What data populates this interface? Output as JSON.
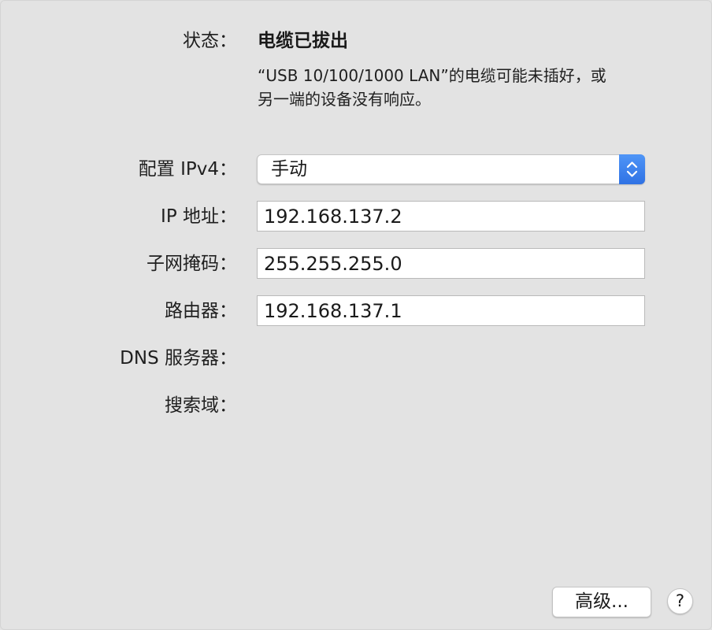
{
  "status": {
    "label": "状态：",
    "value": "电缆已拔出",
    "description_line1": "“USB 10/100/1000 LAN”的电缆可能未插好，或",
    "description_line2": "另一端的设备没有响应。"
  },
  "configure_ipv4": {
    "label": "配置 IPv4：",
    "selected": "手动"
  },
  "ip_address": {
    "label": "IP 地址：",
    "value": "192.168.137.2"
  },
  "subnet_mask": {
    "label": "子网掩码：",
    "value": "255.255.255.0"
  },
  "router": {
    "label": "路由器：",
    "value": "192.168.137.1"
  },
  "dns_servers": {
    "label": "DNS 服务器："
  },
  "search_domains": {
    "label": "搜索域："
  },
  "buttons": {
    "advanced_label": "高级...",
    "help_label": "?"
  },
  "colors": {
    "background": "#e3e3e3",
    "accent": "#3b82f0",
    "field_bg": "#ffffff"
  },
  "icons": {
    "select_arrows": "updown-chevron-icon"
  }
}
